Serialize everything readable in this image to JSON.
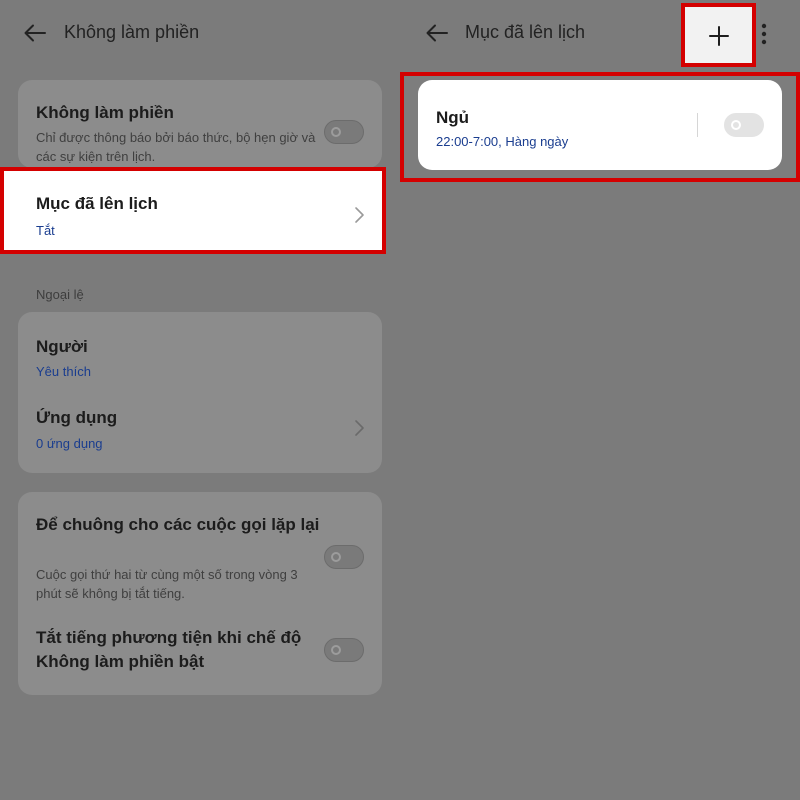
{
  "left": {
    "header": {
      "title": "Không làm phiền"
    },
    "dnd": {
      "title": "Không làm phiền",
      "description": "Chỉ được thông báo bởi báo thức, bộ hẹn giờ và các sự kiện trên lịch.",
      "toggle_on": false
    },
    "scheduled": {
      "title": "Mục đã lên lịch",
      "value": "Tắt"
    },
    "exceptions": {
      "section_label": "Ngoại lệ",
      "people": {
        "title": "Người",
        "value": "Yêu thích"
      },
      "apps": {
        "title": "Ứng dụng",
        "value": "0 ứng dụng"
      }
    },
    "repeat_calls": {
      "title": "Để chuông cho các cuộc gọi lặp lại",
      "description": "Cuộc gọi thứ hai từ cùng một số trong vòng 3 phút sẽ không bị tắt tiếng.",
      "toggle_on": false
    },
    "mute_media": {
      "title": "Tắt tiếng phương tiện khi chế độ Không làm phiền bật",
      "toggle_on": false
    }
  },
  "right": {
    "header": {
      "title": "Mục đã lên lịch"
    },
    "schedules": [
      {
        "name": "Ngủ",
        "time": "22:00-7:00, Hàng ngày",
        "enabled": false
      }
    ]
  },
  "colors": {
    "highlight": "#d40000",
    "link_text": "#1a3d8f",
    "dim_background": "#7b7b7b"
  },
  "icons": [
    "back-arrow-icon",
    "chevron-right-icon",
    "plus-icon",
    "more-vert-icon"
  ]
}
